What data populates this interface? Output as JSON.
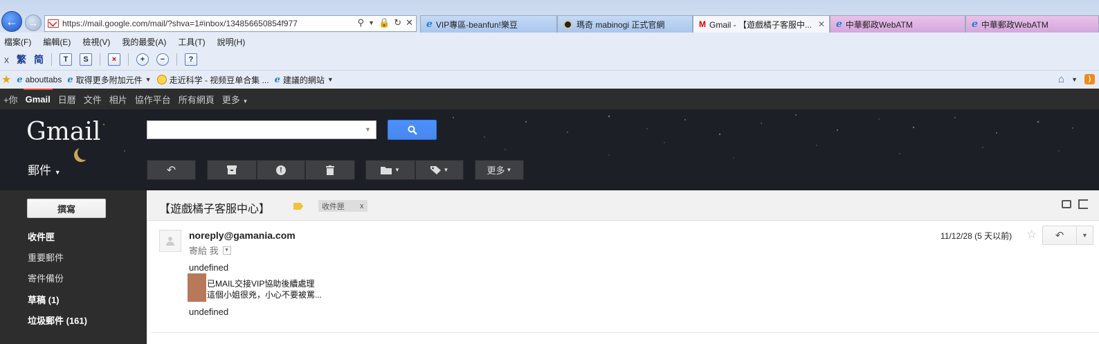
{
  "browser": {
    "url": "https://mail.google.com/mail/?shva=1#inbox/134856650854f977",
    "tabs": [
      {
        "label": "VIP專區-beanfun!樂豆"
      },
      {
        "label": "瑪奇 mabinogi 正式官網"
      },
      {
        "label": "Gmail - 【遊戲橘子客服中..."
      },
      {
        "label": "中華郵政WebATM"
      },
      {
        "label": "中華郵政WebATM"
      }
    ],
    "menu": [
      "檔案(F)",
      "編輯(E)",
      "檢視(V)",
      "我的最愛(A)",
      "工具(T)",
      "說明(H)"
    ],
    "toolbar": {
      "close": "x",
      "trad": "繁",
      "simp": "简"
    },
    "favorites": [
      {
        "label": "abouttabs"
      },
      {
        "label": "取得更多附加元件"
      },
      {
        "label": "走近科学 - 视频豆单合集 ..."
      },
      {
        "label": "建議的網站"
      }
    ]
  },
  "google_bar": {
    "items": [
      "+你",
      "Gmail",
      "日曆",
      "文件",
      "相片",
      "協作平台",
      "所有網頁",
      "更多"
    ]
  },
  "gmail": {
    "logo": "Gmail",
    "search": {
      "value": "",
      "placeholder": ""
    },
    "mail_menu": "郵件",
    "more_button": "更多"
  },
  "sidebar": {
    "compose": "撰寫",
    "items": [
      {
        "label": "收件匣",
        "bold": true
      },
      {
        "label": "重要郵件",
        "bold": false
      },
      {
        "label": "寄件備份",
        "bold": false
      },
      {
        "label": "草稿 (1)",
        "bold": true
      },
      {
        "label": "垃圾郵件 (161)",
        "bold": true
      }
    ]
  },
  "message": {
    "subject": "【遊戲橘子客服中心】",
    "label": "收件匣",
    "label_remove": "x",
    "sender": "noreply@gamania.com",
    "to": "寄給 我",
    "date": "11/12/28 (5 天以前)",
    "body_top": "undefined",
    "body_line1": "已MAIL交接VIP協助後續處理",
    "body_line2": "這個小姐很兇，小心不要被罵...",
    "body_bottom": "undefined"
  },
  "colors": {
    "google_red": "#dd4b39",
    "search_blue": "#4d90fe",
    "header_dark": "#1d1f27",
    "sidebar_dark": "#2d2d2d",
    "important_yellow": "#f0c23d"
  }
}
